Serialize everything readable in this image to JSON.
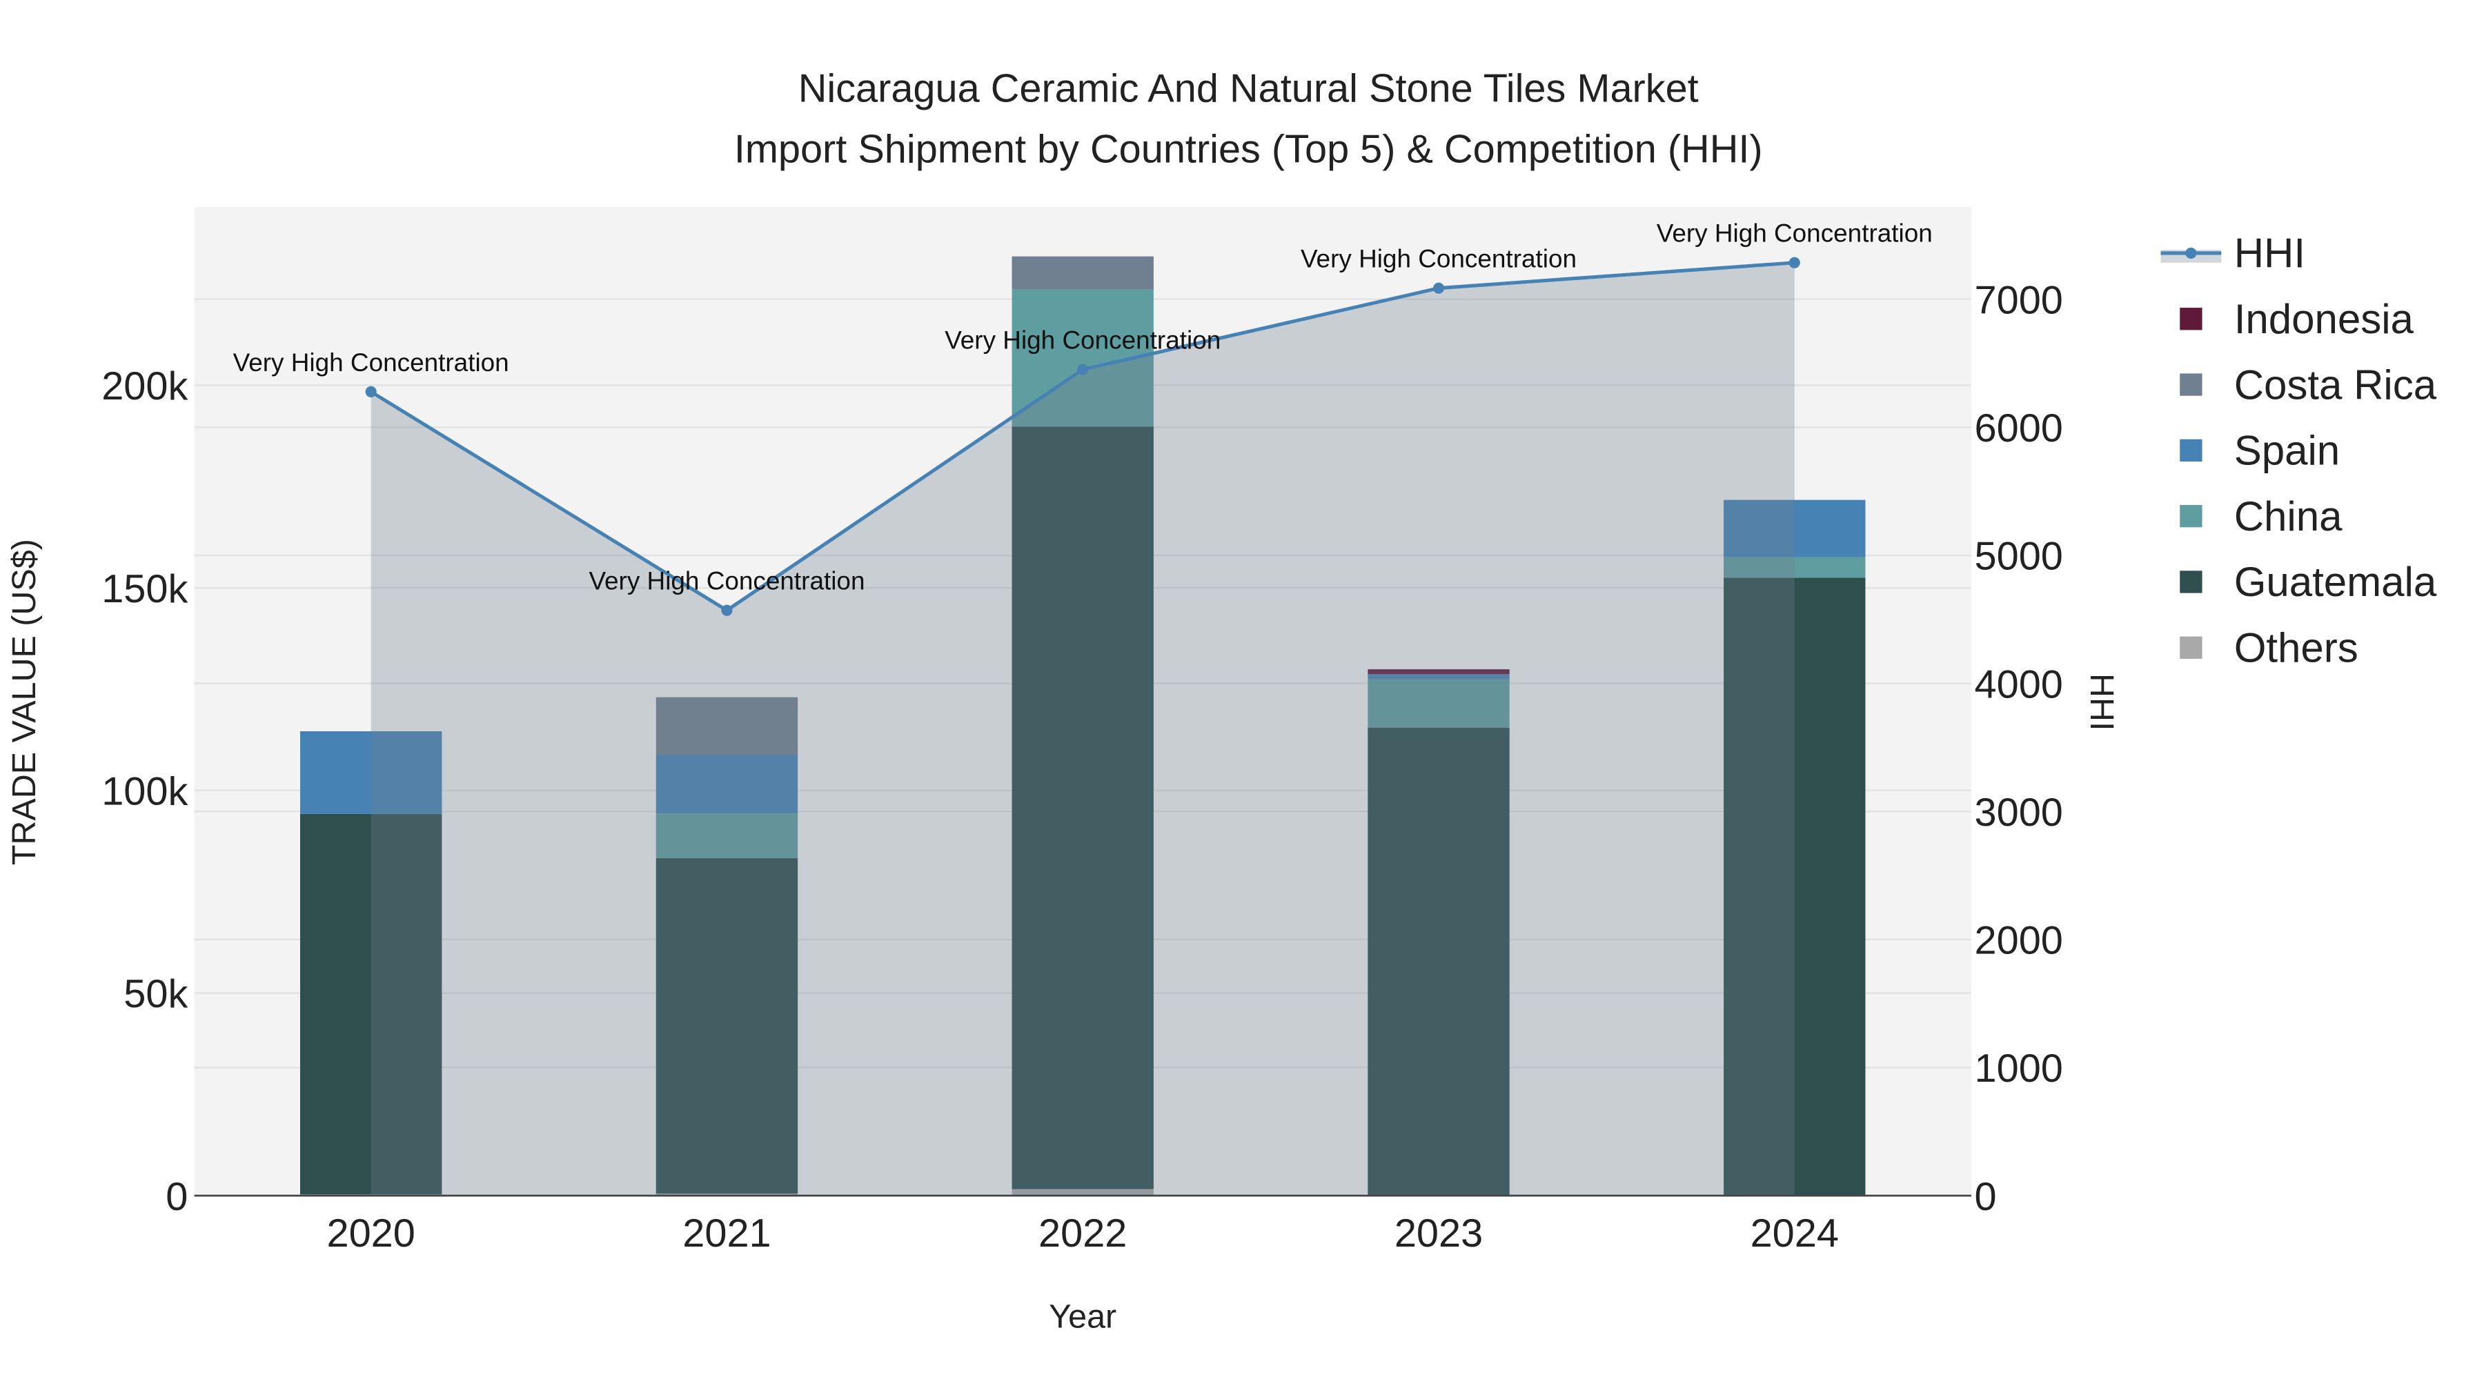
{
  "chart_data": {
    "type": "bar",
    "stacked": true,
    "title_line1": "Nicaragua Ceramic And Natural Stone Tiles Market",
    "title_line2": "Import Shipment by Countries (Top 5) & Competition (HHI)",
    "xlabel": "Year",
    "ylabel": "TRADE VALUE (US$)",
    "y2label": "HHI",
    "categories": [
      "2020",
      "2021",
      "2022",
      "2023",
      "2024"
    ],
    "ylim": [
      0,
      244000
    ],
    "y_ticks": [
      0,
      50000,
      100000,
      150000,
      200000
    ],
    "y_tick_labels": [
      "0",
      "50k",
      "100k",
      "150k",
      "200k"
    ],
    "y2lim": [
      0,
      7720
    ],
    "y2_ticks": [
      0,
      1000,
      2000,
      3000,
      4000,
      5000,
      6000,
      7000
    ],
    "y2_tick_labels": [
      "0",
      "1000",
      "2000",
      "3000",
      "4000",
      "5000",
      "6000",
      "7000"
    ],
    "grid": true,
    "legend_placement": "right",
    "series": [
      {
        "name": "Others",
        "color": "#a9a9a9",
        "values": [
          300,
          500,
          1600,
          0,
          0
        ]
      },
      {
        "name": "Guatemala",
        "color": "#2f4f4f",
        "values": [
          93900,
          82800,
          188200,
          115500,
          152500
        ]
      },
      {
        "name": "China",
        "color": "#5f9ea0",
        "values": [
          0,
          11000,
          33800,
          11900,
          5100
        ]
      },
      {
        "name": "Spain",
        "color": "#4682b4",
        "values": [
          20400,
          14500,
          0,
          1300,
          14100
        ]
      },
      {
        "name": "Costa Rica",
        "color": "#708090",
        "values": [
          0,
          14200,
          8200,
          0,
          0
        ]
      },
      {
        "name": "Indonesia",
        "color": "#5f1a3a",
        "values": [
          0,
          0,
          0,
          1200,
          0
        ]
      }
    ],
    "legend_order": [
      "HHI",
      "Indonesia",
      "Costa Rica",
      "Spain",
      "China",
      "Guatemala",
      "Others"
    ],
    "hhi": {
      "name": "HHI",
      "color": "#4682b4",
      "values": [
        6277,
        4570,
        6451,
        7086,
        7285
      ],
      "annotations": [
        "Very High Concentration",
        "Very High Concentration",
        "Very High Concentration",
        "Very High Concentration",
        "Very High Concentration"
      ]
    }
  }
}
